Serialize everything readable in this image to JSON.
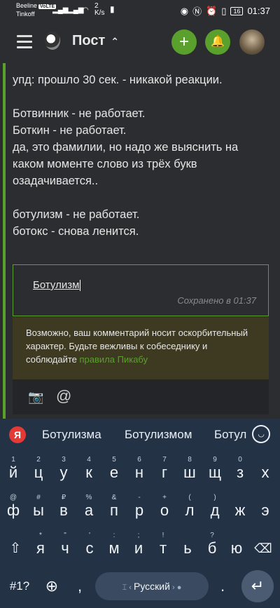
{
  "status_bar": {
    "carrier_1": "Beeline",
    "carrier_badge": "VoLTE",
    "carrier_2": "Tinkoff",
    "speed_value": "2",
    "speed_unit": "K/s",
    "battery": "16",
    "time": "01:37"
  },
  "app_bar": {
    "title": "Пост",
    "add_label": "+"
  },
  "post": {
    "line1": "упд: прошло 30 сек. - никакой реакции.",
    "line2": "Ботвинник - не работает.",
    "line3": "Боткин - не работает.",
    "line4": "да, это фамилии, но надо же выяснить на каком моменте слово из трёх букв озадачивается..",
    "line5": "ботулизм - не работает.",
    "line6": "ботокс - снова ленится."
  },
  "comment_editor": {
    "value": "Ботулизм",
    "saved_text": "Сохранено в 01:37"
  },
  "warning": {
    "text": "Возможно, ваш комментарий носит оскорбительный характер. Будьте вежливы к собеседнику и соблюдайте ",
    "link_text": "правила Пикабу"
  },
  "keyboard": {
    "yandex_logo": "Я",
    "suggestions": [
      "Ботулизма",
      "Ботулизмом",
      "Ботул"
    ],
    "row1": [
      {
        "k": "й",
        "s": "1"
      },
      {
        "k": "ц",
        "s": "2"
      },
      {
        "k": "у",
        "s": "3"
      },
      {
        "k": "к",
        "s": "4"
      },
      {
        "k": "е",
        "s": "5"
      },
      {
        "k": "н",
        "s": "6"
      },
      {
        "k": "г",
        "s": "7"
      },
      {
        "k": "ш",
        "s": "8"
      },
      {
        "k": "щ",
        "s": "9"
      },
      {
        "k": "з",
        "s": "0"
      },
      {
        "k": "х",
        "s": ""
      }
    ],
    "row2": [
      {
        "k": "ф",
        "s": "@"
      },
      {
        "k": "ы",
        "s": "#"
      },
      {
        "k": "в",
        "s": "₽"
      },
      {
        "k": "а",
        "s": "%"
      },
      {
        "k": "п",
        "s": "&"
      },
      {
        "k": "р",
        "s": "-"
      },
      {
        "k": "о",
        "s": "+"
      },
      {
        "k": "л",
        "s": "("
      },
      {
        "k": "д",
        "s": ")"
      },
      {
        "k": "ж",
        "s": ""
      },
      {
        "k": "э",
        "s": ""
      }
    ],
    "row3": [
      {
        "k": "я",
        "s": "*"
      },
      {
        "k": "ч",
        "s": "\""
      },
      {
        "k": "с",
        "s": "'"
      },
      {
        "k": "м",
        "s": ":"
      },
      {
        "k": "и",
        "s": ";"
      },
      {
        "k": "т",
        "s": "!"
      },
      {
        "k": "ь",
        "s": ""
      },
      {
        "k": "б",
        "s": "?"
      },
      {
        "k": "ю",
        "s": ""
      }
    ],
    "symbols_label": "#1?",
    "comma": ",",
    "space_label": "Русский",
    "period": ".",
    "shift_icon": "shift-icon",
    "backspace_icon": "backspace-icon",
    "enter_icon": "enter-icon"
  }
}
